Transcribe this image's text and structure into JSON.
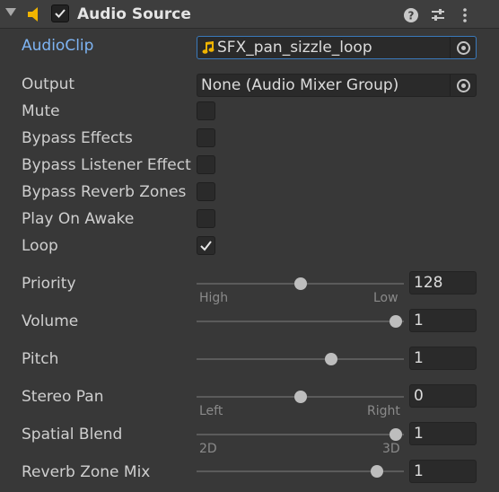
{
  "header": {
    "title": "Audio Source",
    "enabled": true,
    "icons": [
      "foldout-arrow",
      "audio-source-icon",
      "help-icon",
      "preset-icon",
      "more-menu-icon"
    ]
  },
  "fields": {
    "audio_clip": {
      "label": "AudioClip",
      "value": "SFX_pan_sizzle_loop",
      "icon": "music-note-icon"
    },
    "output": {
      "label": "Output",
      "value": "None (Audio Mixer Group)"
    },
    "mute": {
      "label": "Mute",
      "checked": false
    },
    "bypass_effects": {
      "label": "Bypass Effects",
      "checked": false
    },
    "bypass_listener_effects": {
      "label": "Bypass Listener Effect",
      "checked": false
    },
    "bypass_reverb_zones": {
      "label": "Bypass Reverb Zones",
      "checked": false
    },
    "play_on_awake": {
      "label": "Play On Awake",
      "checked": false
    },
    "loop": {
      "label": "Loop",
      "checked": true
    }
  },
  "sliders": {
    "priority": {
      "label": "Priority",
      "value": "128",
      "fraction": 0.5,
      "min_label": "High",
      "max_label": "Low"
    },
    "volume": {
      "label": "Volume",
      "value": "1",
      "fraction": 1.0
    },
    "pitch": {
      "label": "Pitch",
      "value": "1",
      "fraction": 0.66
    },
    "stereo_pan": {
      "label": "Stereo Pan",
      "value": "0",
      "fraction": 0.5,
      "min_label": "Left",
      "max_label": "Right"
    },
    "spatial_blend": {
      "label": "Spatial Blend",
      "value": "1",
      "fraction": 1.0,
      "min_label": "2D",
      "max_label": "3D"
    },
    "reverb_zone_mix": {
      "label": "Reverb Zone Mix",
      "value": "1",
      "fraction": 0.9
    }
  },
  "colors": {
    "background": "#383838",
    "accent_label": "#7eb4f3",
    "focus_border": "#3a79bb",
    "audio_icon": "#f0b400"
  }
}
